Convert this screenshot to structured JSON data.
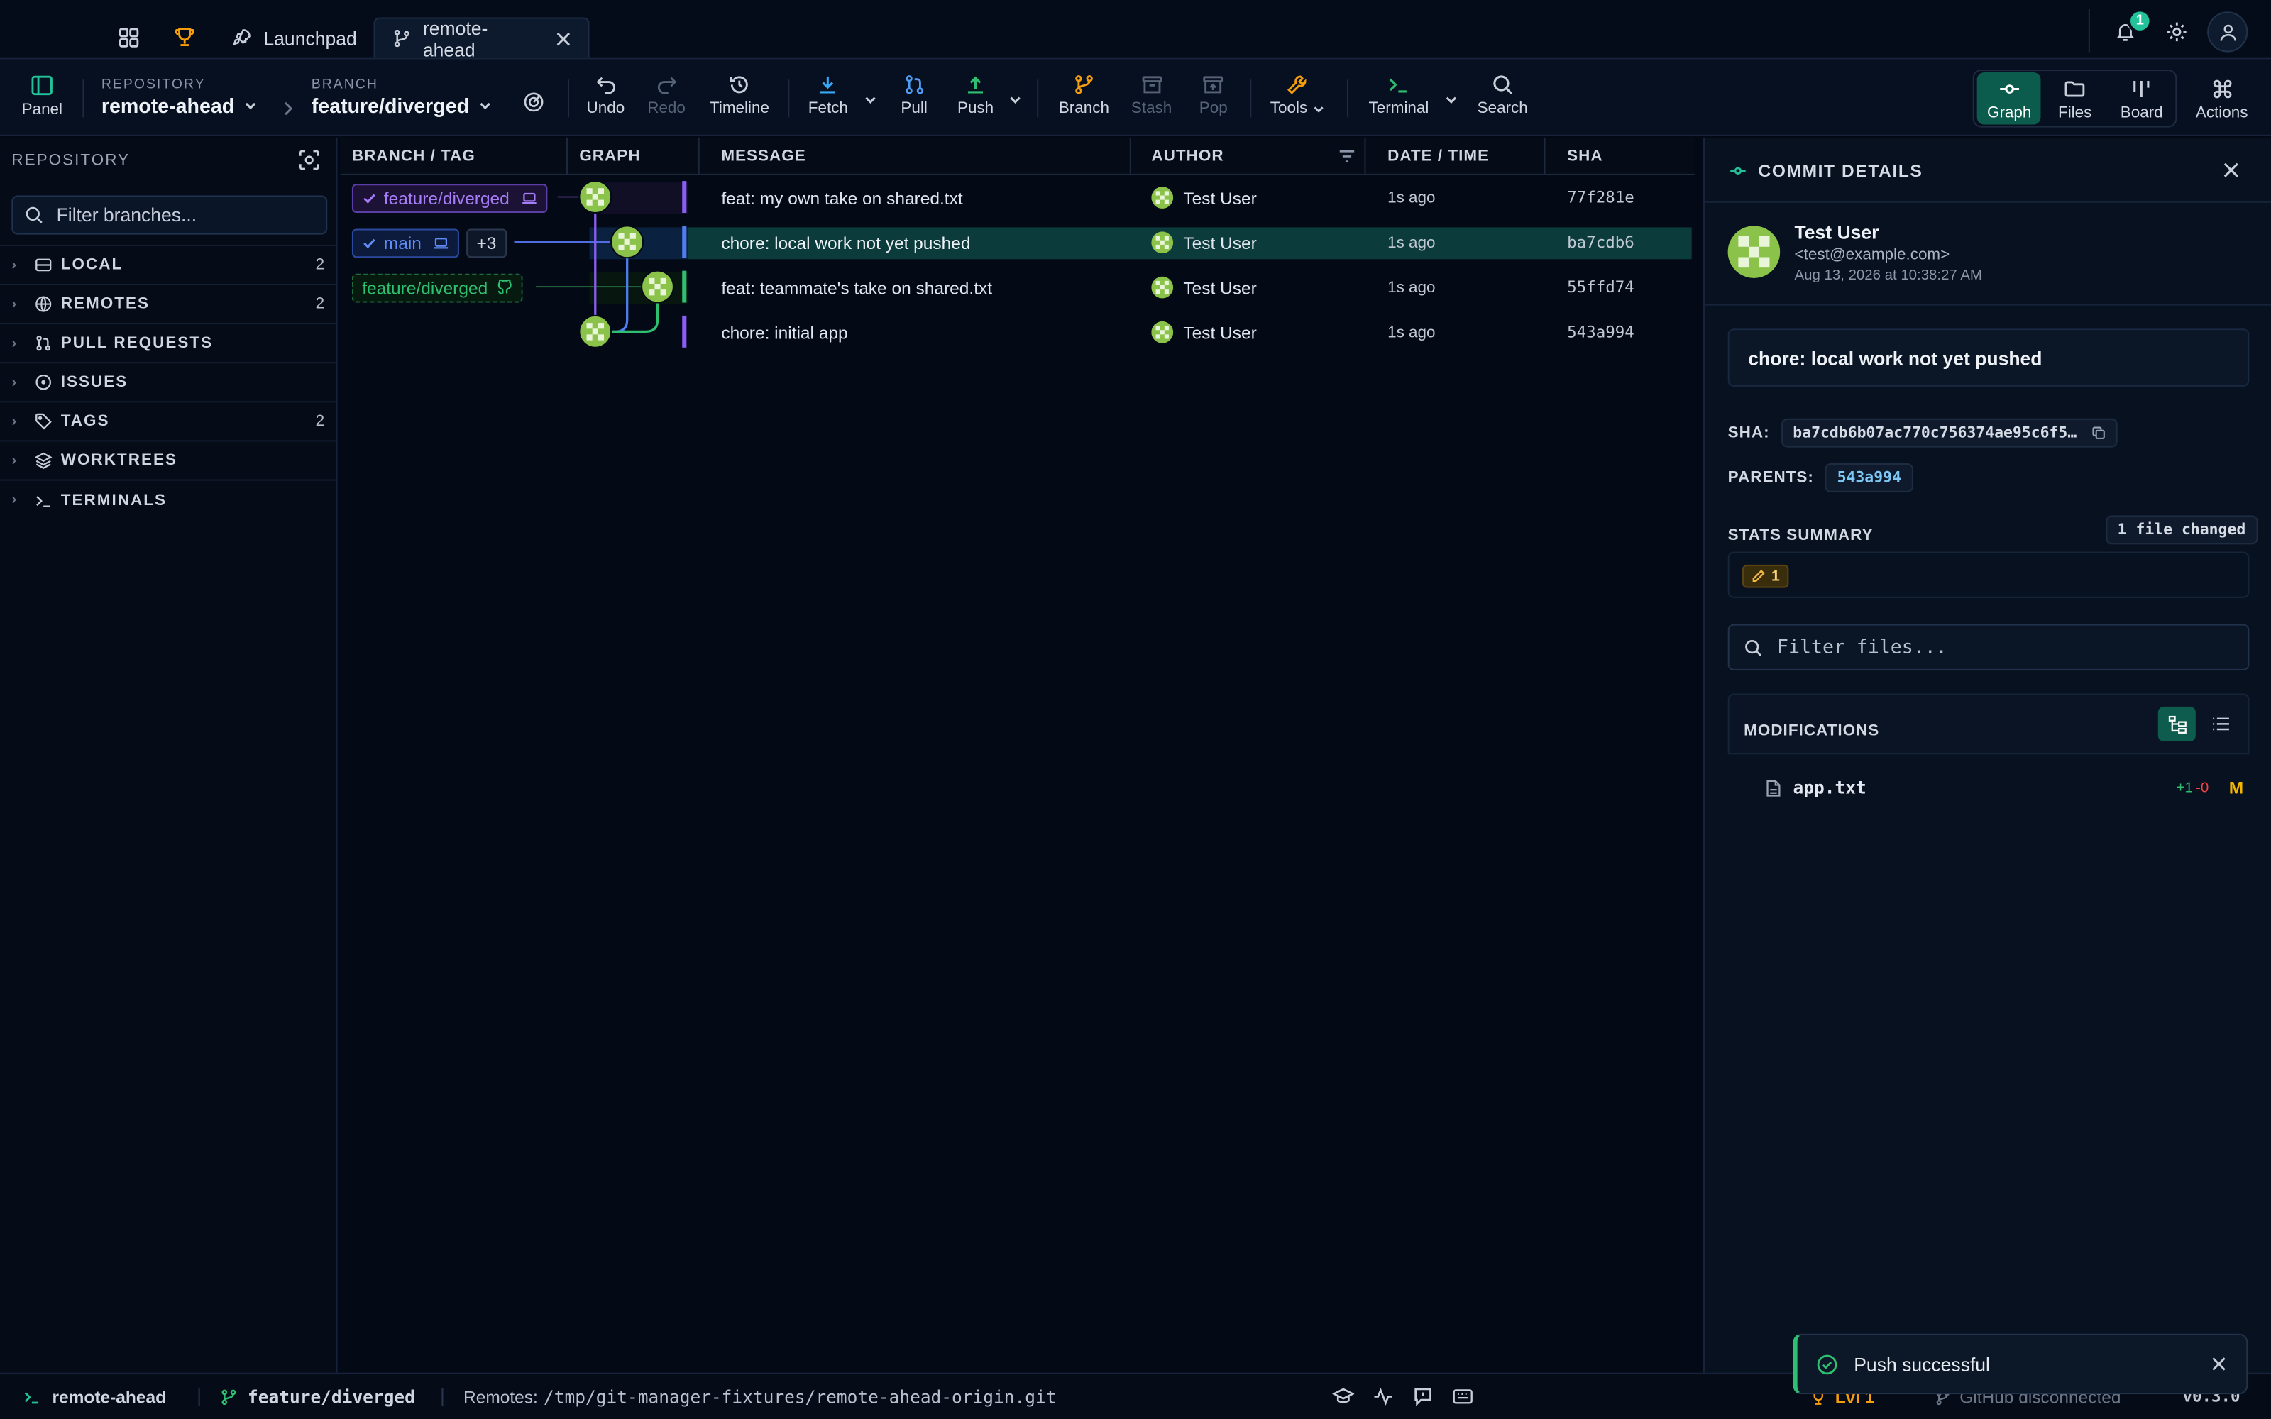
{
  "tabs": {
    "launchpad_label": "Launchpad",
    "active_label": "remote-ahead",
    "notification_count": "1"
  },
  "toolbar": {
    "panel_label": "Panel",
    "repository_caption": "REPOSITORY",
    "repository_name": "remote-ahead",
    "branch_caption": "BRANCH",
    "branch_name": "feature/diverged",
    "undo": "Undo",
    "redo": "Redo",
    "timeline": "Timeline",
    "fetch": "Fetch",
    "pull": "Pull",
    "push": "Push",
    "branch": "Branch",
    "stash": "Stash",
    "pop": "Pop",
    "tools": "Tools",
    "terminal": "Terminal",
    "search": "Search",
    "view_graph": "Graph",
    "view_files": "Files",
    "view_board": "Board",
    "actions": "Actions"
  },
  "sidebar": {
    "title": "REPOSITORY",
    "filter_placeholder": "Filter branches...",
    "sections": [
      {
        "label": "LOCAL",
        "count": "2",
        "icon": "drive-icon"
      },
      {
        "label": "REMOTES",
        "count": "2",
        "icon": "globe-icon"
      },
      {
        "label": "PULL REQUESTS",
        "count": "",
        "icon": "pull-request-icon"
      },
      {
        "label": "ISSUES",
        "count": "",
        "icon": "issue-icon"
      },
      {
        "label": "TAGS",
        "count": "2",
        "icon": "tag-icon"
      },
      {
        "label": "WORKTREES",
        "count": "",
        "icon": "layers-icon"
      },
      {
        "label": "TERMINALS",
        "count": "",
        "icon": "terminal-icon"
      }
    ]
  },
  "graph": {
    "columns": [
      "BRANCH / TAG",
      "GRAPH",
      "MESSAGE",
      "AUTHOR",
      "DATE / TIME",
      "SHA"
    ],
    "rows": [
      {
        "ref": "feature/diverged",
        "extra": "",
        "message": "feat: my own take on shared.txt",
        "author": "Test User",
        "date": "1s ago",
        "sha": "77f281e"
      },
      {
        "ref": "main",
        "extra": "+3",
        "message": "chore: local work not yet pushed",
        "author": "Test User",
        "date": "1s ago",
        "sha": "ba7cdb6"
      },
      {
        "ref": "feature/diverged",
        "extra": "",
        "message": "feat: teammate's take on shared.txt",
        "author": "Test User",
        "date": "1s ago",
        "sha": "55ffd74"
      },
      {
        "ref": "",
        "extra": "",
        "message": "chore: initial app",
        "author": "Test User",
        "date": "1s ago",
        "sha": "543a994"
      }
    ]
  },
  "details": {
    "title": "COMMIT DETAILS",
    "author_name": "Test User",
    "author_email": "<test@example.com>",
    "date": "Aug 13, 2026 at 10:38:27 AM",
    "message": "chore: local work not yet pushed",
    "sha_label": "SHA:",
    "sha_value": "ba7cdb6b07ac770c756374ae95c6f5…",
    "parents_label": "PARENTS:",
    "parent_value": "543a994",
    "stats_label": "STATS SUMMARY",
    "files_changed": "1 file changed",
    "modified_count": "1",
    "filter_files_placeholder": "Filter files...",
    "modifications_label": "MODIFICATIONS",
    "file_name": "app.txt",
    "file_additions": "+1",
    "file_deletions": "-0",
    "file_status": "M"
  },
  "statusbar": {
    "repo": "remote-ahead",
    "branch": "feature/diverged",
    "remotes_label": "Remotes:",
    "remotes_path": "/tmp/git-manager-fixtures/remote-ahead-origin.git",
    "level": "Lvl 1",
    "github": "GitHub disconnected",
    "version": "v0.3.0"
  },
  "toast": {
    "message": "Push successful"
  },
  "colors": {
    "accent": "#22c39a",
    "purple": "#9b5cf6",
    "blue": "#4f7df0",
    "green": "#2fbf71",
    "selected_row": "#0b3b3a"
  }
}
